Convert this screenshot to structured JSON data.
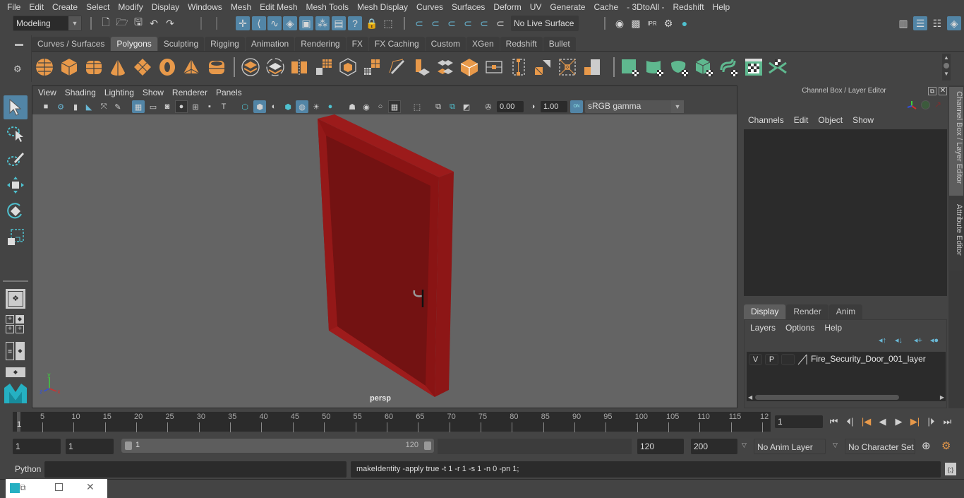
{
  "menubar": {
    "items": [
      "File",
      "Edit",
      "Create",
      "Select",
      "Modify",
      "Display",
      "Windows",
      "Mesh",
      "Edit Mesh",
      "Mesh Tools",
      "Mesh Display",
      "Curves",
      "Surfaces",
      "Deform",
      "UV",
      "Generate",
      "Cache",
      "- 3DtoAll -",
      "Redshift",
      "Help"
    ]
  },
  "statusline": {
    "mode_selector": "Modeling",
    "live_surface": "No Live Surface"
  },
  "shelf": {
    "tabs": [
      "Curves / Surfaces",
      "Polygons",
      "Sculpting",
      "Rigging",
      "Animation",
      "Rendering",
      "FX",
      "FX Caching",
      "Custom",
      "XGen",
      "Redshift",
      "Bullet"
    ],
    "active_tab": "Polygons"
  },
  "viewport": {
    "menu": [
      "View",
      "Shading",
      "Lighting",
      "Show",
      "Renderer",
      "Panels"
    ],
    "exposure": "0.00",
    "gamma": "1.00",
    "color_management_toggle": "ON",
    "color_space": "sRGB gamma",
    "camera_label": "persp",
    "axis_labels": {
      "x": "x",
      "y": "y",
      "z": "z"
    }
  },
  "right_panel": {
    "title": "Channel Box / Layer Editor",
    "menu": [
      "Channels",
      "Edit",
      "Object",
      "Show"
    ],
    "layer_tabs": [
      "Display",
      "Render",
      "Anim"
    ],
    "active_layer_tab": "Display",
    "layer_menu": [
      "Layers",
      "Options",
      "Help"
    ],
    "layers": [
      {
        "visible": "V",
        "playback": "P",
        "name": "Fire_Security_Door_001_layer"
      }
    ],
    "side_tabs": [
      "Channel Box / Layer Editor",
      "Attribute Editor"
    ]
  },
  "timeslider": {
    "ticks": [
      "5",
      "10",
      "15",
      "20",
      "25",
      "30",
      "35",
      "40",
      "45",
      "50",
      "55",
      "60",
      "65",
      "70",
      "75",
      "80",
      "85",
      "90",
      "95",
      "100",
      "105",
      "110",
      "115",
      "12"
    ],
    "current_frame_marker": "1",
    "current_frame": "1"
  },
  "rangeslider": {
    "start_frame": "1",
    "playback_start": "1",
    "range_start_label": "1",
    "range_end_label": "120",
    "playback_end": "120",
    "end_frame": "200",
    "anim_layer": "No Anim Layer",
    "character_set": "No Character Set"
  },
  "cmdline": {
    "language": "Python",
    "input": "",
    "result": "makeIdentity -apply true -t 1 -r 1 -s 1 -n 0 -pn 1;"
  },
  "colors": {
    "accent_blue": "#5285a6",
    "poly_orange": "#e8994a",
    "teal_green": "#5fb88f",
    "door_red": "#8a1414"
  }
}
